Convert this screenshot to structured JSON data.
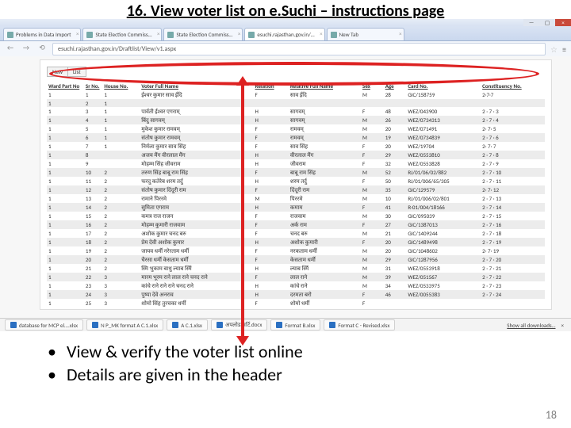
{
  "title": "16.  View voter list on e.Suchi – instructions page",
  "browser": {
    "tabs": [
      {
        "label": "Problems in Data Import"
      },
      {
        "label": "State Election Commiss…"
      },
      {
        "label": "State Election Commiss…"
      },
      {
        "label": "esuchi.rajasthan.gov.in/…"
      },
      {
        "label": "New Tab"
      }
    ],
    "active_tab_index": 3,
    "url_text": "esuchi.rajasthan.gov.in/Draftlist/View/v1.aspx",
    "nav": {
      "back": "←",
      "fwd": "→",
      "reload": "⟲"
    },
    "star": "☆",
    "menu": "≡"
  },
  "view_tabs": {
    "tab1": "New",
    "tab2": "List"
  },
  "columns": {
    "ward": "Ward Part No",
    "sr": "Sr No.",
    "house": "House No.",
    "voter": "Voter Full Name",
    "relation": "Relation",
    "rfn": "Relative Full Name",
    "sex": "Sex",
    "age": "Age",
    "card": "Card No.",
    "cno": "Constituency No."
  },
  "rows": [
    {
      "wp": "1",
      "sr": "1",
      "hn": "1",
      "vn": "ईश्वर कुमार साव ईदि",
      "rel": "F",
      "rfn": "साव ईदि",
      "sex": "M",
      "age": "28",
      "card": "GIC/158759",
      "cno": "2·7·7"
    },
    {
      "wp": "1",
      "sr": "2",
      "hn": "1",
      "vn": "",
      "rel": "",
      "rfn": "",
      "sex": "",
      "age": "",
      "card": "",
      "cno": ""
    },
    {
      "wp": "1",
      "sr": "3",
      "hn": "1",
      "vn": "पार्वती ईश्वर एगराम्",
      "rel": "H",
      "rfn": "सागवम्",
      "sex": "F",
      "age": "48",
      "card": "WEZ/043900",
      "cno": "2 · 7 · 3"
    },
    {
      "wp": "1",
      "sr": "4",
      "hn": "1",
      "vn": "बिंदु सागवम्",
      "rel": "H",
      "rfn": "सागवम्",
      "sex": "M",
      "age": "26",
      "card": "WEZ/0734313",
      "cno": "2 · 7 · 4"
    },
    {
      "wp": "1",
      "sr": "5",
      "hn": "1",
      "vn": "मुकेश कुमार रामवम्",
      "rel": "F",
      "rfn": "रामवम्",
      "sex": "M",
      "age": "20",
      "card": "WEZ/071491",
      "cno": "2· 7· 5"
    },
    {
      "wp": "1",
      "sr": "6",
      "hn": "1",
      "vn": "संतोष कुमार रामवम्",
      "rel": "F",
      "rfn": "रामवम्",
      "sex": "M",
      "age": "19",
      "card": "WEZ/0734839",
      "cno": "2 · 7 · 6"
    },
    {
      "wp": "1",
      "sr": "7",
      "hn": "1",
      "vn": "निर्मला कुमार साव सिंह",
      "rel": "F",
      "rfn": "साव सिंह",
      "sex": "F",
      "age": "20",
      "card": "WEZ/19704",
      "cno": "2· 7· 7"
    },
    {
      "wp": "1",
      "sr": "8",
      "hn": "",
      "vn": "अजय मैंग वीरलाल मैंग",
      "rel": "H",
      "rfn": "वीरलाल मैंग",
      "sex": "F",
      "age": "29",
      "card": "WEZ/0553810",
      "cno": "2 · 7 · 8"
    },
    {
      "wp": "1",
      "sr": "9",
      "hn": "",
      "vn": "मोहम्म सिंह जीवराम",
      "rel": "H",
      "rfn": "जीवराम",
      "sex": "F",
      "age": "32",
      "card": "WEZ/0553828",
      "cno": "2 · 7 · 9"
    },
    {
      "wp": "1",
      "sr": "10",
      "hn": "2",
      "vn": "तरुण सिंह बाबू राम सिंह",
      "rel": "F",
      "rfn": "बाबू राम सिंह",
      "sex": "M",
      "age": "52",
      "card": "RJ/01/06/02/882",
      "cno": "2 · 7 · 10"
    },
    {
      "wp": "1",
      "sr": "11",
      "hn": "2",
      "vn": "फरदु कतेरेब शरम तर्दु",
      "rel": "H",
      "rfn": "शरम तर्दु",
      "sex": "F",
      "age": "50",
      "card": "RJ/01/006/65/305",
      "cno": "2 · 7 · 11"
    },
    {
      "wp": "1",
      "sr": "12",
      "hn": "2",
      "vn": "संतोष कुमार दिंदूरी राम",
      "rel": "F",
      "rfn": "दिंदूरी राम",
      "sex": "M",
      "age": "35",
      "card": "GIC/129579",
      "cno": "2· 7· 12"
    },
    {
      "wp": "1",
      "sr": "13",
      "hn": "2",
      "vn": "रामाने पिररमे",
      "rel": "M",
      "rfn": "पिररमे",
      "sex": "M",
      "age": "10",
      "card": "RJ/01/006/02/801",
      "cno": "2 · 7 · 13"
    },
    {
      "wp": "1",
      "sr": "14",
      "hn": "2",
      "vn": "सुमिता एगराम",
      "rel": "H",
      "rfn": "कमाम",
      "sex": "F",
      "age": "41",
      "card": "R·01/004/18166",
      "cno": "2 · 7 · 14"
    },
    {
      "wp": "1",
      "sr": "15",
      "hn": "2",
      "vn": "कमत्र राज राजन",
      "rel": "F",
      "rfn": "राजवाम",
      "sex": "M",
      "age": "30",
      "card": "GIC/095039",
      "cno": "2 · 7 · 15"
    },
    {
      "wp": "1",
      "sr": "16",
      "hn": "2",
      "vn": "मोहम्म कुमारी राजवाम",
      "rel": "F",
      "rfn": "अर्क राम",
      "sex": "F",
      "age": "27",
      "card": "GIC/1387013",
      "cno": "2 · 7 · 16"
    },
    {
      "wp": "1",
      "sr": "17",
      "hn": "2",
      "vn": "अशोक कुमार चनद बरु",
      "rel": "F",
      "rfn": "चनद बरु",
      "sex": "M",
      "age": "21",
      "card": "GIC/1409244",
      "cno": "2 · 7 · 18"
    },
    {
      "wp": "1",
      "sr": "18",
      "hn": "2",
      "vn": "प्रेम देवी अशोक कुमार",
      "rel": "H",
      "rfn": "अशोक कुमारी",
      "sex": "F",
      "age": "20",
      "card": "GIC/1489498",
      "cno": "2 · 7 · 19"
    },
    {
      "wp": "1",
      "sr": "19",
      "hn": "2",
      "vn": "जायव धर्मी नरेरताम धर्मी",
      "rel": "F",
      "rfn": "नरकताम धर्मी",
      "sex": "M",
      "age": "20",
      "card": "GIC/1048602",
      "cno": "2· 7· 19"
    },
    {
      "wp": "1",
      "sr": "20",
      "hn": "2",
      "vn": "चैरसा धर्मी केसताम धर्मी",
      "rel": "F",
      "rfn": "केसताम धर्मी",
      "sex": "M",
      "age": "29",
      "card": "GIC/1287956",
      "cno": "2 · 7 · 20"
    },
    {
      "wp": "1",
      "sr": "21",
      "hn": "2",
      "vn": "स्मि भुकाम बाथु ल्याब र्स्मि",
      "rel": "H",
      "rfn": "ल्याब र्स्मि",
      "sex": "M",
      "age": "31",
      "card": "WEZ/0553918",
      "cno": "2 · 7 · 21"
    },
    {
      "wp": "1",
      "sr": "22",
      "hn": "3",
      "vn": "मारम भूरम राने लाल राने चनद राने",
      "rel": "F",
      "rfn": "लाल राने",
      "sex": "M",
      "age": "39",
      "card": "WEZ/051567",
      "cno": "2 · 7 · 22"
    },
    {
      "wp": "1",
      "sr": "23",
      "hn": "3",
      "vn": "कांचे राने राने राने चनद राने",
      "rel": "H",
      "rfn": "कांचे राने",
      "sex": "M",
      "age": "34",
      "card": "WEZ/0533975",
      "cno": "2 · 7 · 23"
    },
    {
      "wp": "1",
      "sr": "24",
      "hn": "3",
      "vn": "पुष्पा देवे अनराव",
      "rel": "H",
      "rfn": "दरमता बरो",
      "sex": "F",
      "age": "46",
      "card": "WEZ/0055383",
      "cno": "2 · 7 · 24"
    },
    {
      "wp": "1",
      "sr": "25",
      "hn": "3",
      "vn": "शोमो सिंह तुरचका धर्मी",
      "rel": "F",
      "rfn": "शोमो धर्मी",
      "sex": "F",
      "age": "",
      "card": "",
      "cno": ""
    }
  ],
  "downloads": {
    "items": [
      "database for MCP el….xlsx",
      "N P_MK format A C.1.xlsx",
      "A C.1.xlsx",
      "अपलोड सर्टि.docx",
      "Format B.xlsx",
      "Format C - Revised.xlsx"
    ],
    "show_all": "Show all downloads…",
    "close": "×"
  },
  "bullets": {
    "items": [
      "View  & verify the voter list online",
      "Details are given in the header"
    ]
  },
  "page_number": "18"
}
